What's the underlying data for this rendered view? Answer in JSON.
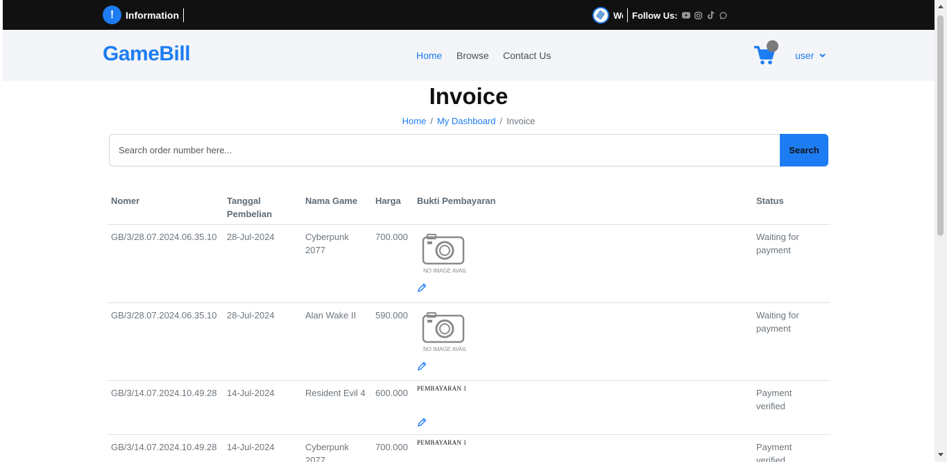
{
  "topbar": {
    "info_label": "Information",
    "welcome_text": "Welcome",
    "follow_label": "Follow Us:",
    "social_icons": [
      "youtube-icon",
      "instagram-icon",
      "tiktok-icon",
      "whatsapp-icon"
    ]
  },
  "navbar": {
    "brand": "GameBill",
    "links": [
      "Home",
      "Browse",
      "Contact Us"
    ],
    "active_link": "Home",
    "user_label": "user"
  },
  "page": {
    "title": "Invoice",
    "breadcrumb": [
      "Home",
      "My Dashboard",
      "Invoice"
    ]
  },
  "search": {
    "placeholder": "Search order number here...",
    "button_label": "Search"
  },
  "table": {
    "headers": [
      "Nomer",
      "Tanggal Pembelian",
      "Nama Game",
      "Harga",
      "Bukti Pembayaran",
      "Status"
    ],
    "rows": [
      {
        "nomer": "GB/3/28.07.2024.06.35.10",
        "tanggal": "28-Jul-2024",
        "game": "Cyberpunk 2077",
        "harga": "700.000",
        "bukti": "NO IMAGE AVAILABLE",
        "status": "Waiting for payment"
      },
      {
        "nomer": "GB/3/28.07.2024.06.35.10",
        "tanggal": "28-Jul-2024",
        "game": "Alan Wake II",
        "harga": "590.000",
        "bukti": "NO IMAGE AVAILABLE",
        "status": "Waiting for payment"
      },
      {
        "nomer": "GB/3/14.07.2024.10.49.28",
        "tanggal": "14-Jul-2024",
        "game": "Resident Evil 4",
        "harga": "600.000",
        "bukti": "PEMBAYARAN 1",
        "status": "Payment verified"
      },
      {
        "nomer": "GB/3/14.07.2024.10.49.28",
        "tanggal": "14-Jul-2024",
        "game": "Cyberpunk 2077",
        "harga": "700.000",
        "bukti": "PEMBAYARAN 1",
        "status": "Payment verified"
      }
    ]
  },
  "colors": {
    "accent": "#1d7cf2",
    "topbar_bg": "#111111",
    "navbar_bg": "#f3f5f8"
  }
}
